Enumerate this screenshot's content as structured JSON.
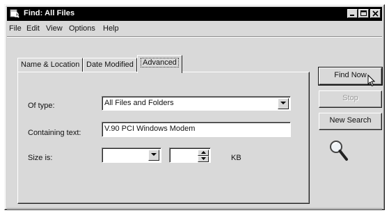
{
  "window": {
    "title": "Find: All Files",
    "icon": "find-icon"
  },
  "menu": [
    "File",
    "Edit",
    "View",
    "Options",
    "Help"
  ],
  "tabs": [
    {
      "label": "Name & Location",
      "active": false
    },
    {
      "label": "Date Modified",
      "active": false
    },
    {
      "label": "Advanced",
      "active": true
    }
  ],
  "form": {
    "of_type": {
      "label": "Of type:",
      "value": "All Files and Folders"
    },
    "containing_text": {
      "label": "Containing text:",
      "value": "V.90 PCI Windows Modem"
    },
    "size_is": {
      "label": "Size is:",
      "value": "",
      "amount": "",
      "unit": "KB"
    }
  },
  "buttons": {
    "find_now": "Find Now",
    "stop": "Stop",
    "new_search": "New Search"
  },
  "icons": {
    "magnifier": "magnifier-icon",
    "cursor": "mouse-pointer-icon"
  }
}
